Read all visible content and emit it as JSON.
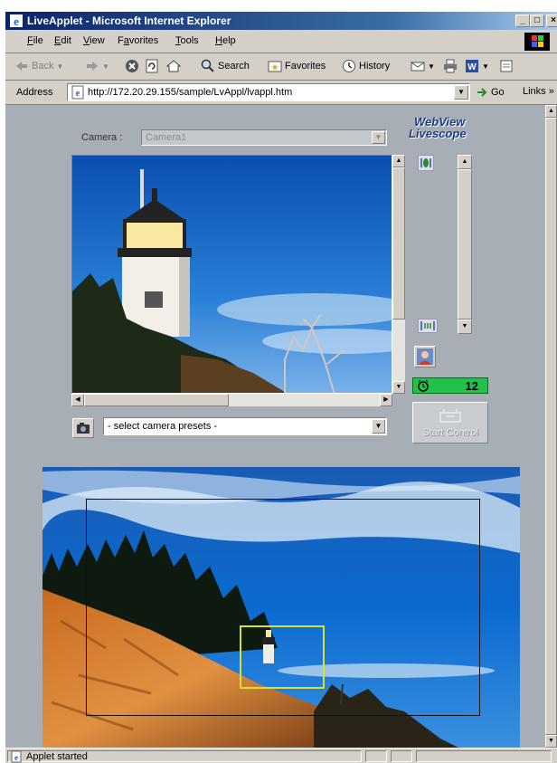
{
  "window": {
    "title": "LiveApplet - Microsoft Internet Explorer"
  },
  "menu": [
    {
      "label": "File",
      "key": "F",
      "rest": "ile"
    },
    {
      "label": "Edit",
      "key": "E",
      "rest": "dit"
    },
    {
      "label": "View",
      "key": "V",
      "rest": "iew"
    },
    {
      "label": "Favorites",
      "key": "a",
      "pre": "F",
      "rest": "vorites"
    },
    {
      "label": "Tools",
      "key": "T",
      "rest": "ools"
    },
    {
      "label": "Help",
      "key": "H",
      "rest": "elp"
    }
  ],
  "toolbar": {
    "back": "Back",
    "search": "Search",
    "favorites": "Favorites",
    "history": "History"
  },
  "address": {
    "label": "Address",
    "url": "http://172.20.29.155/sample/LvAppl/lvappl.htm",
    "go": "Go",
    "links": "Links"
  },
  "applet": {
    "camera_label": "Camera :",
    "camera_value": "Camera1",
    "brand_line1": "WebView",
    "brand_line2": "Livescope",
    "zoom_value": "12",
    "preset_placeholder": "- select camera presets -",
    "start_control": "Start Control",
    "colors": {
      "counter_bg": "#22c24a",
      "brand": "#1e3c8c",
      "frame": "#d8e030"
    }
  },
  "status": {
    "text": "Applet started"
  }
}
